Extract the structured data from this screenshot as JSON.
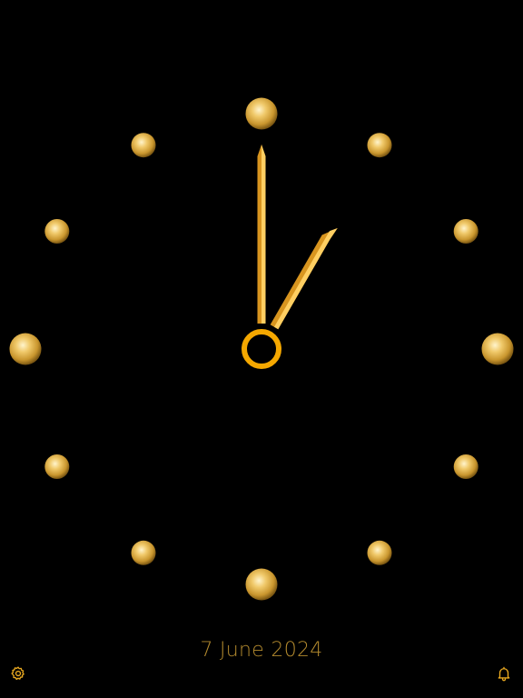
{
  "date_text": "7 June 2024",
  "clock": {
    "time": {
      "hour": 1,
      "minute": 0
    },
    "colors": {
      "background": "#000000",
      "hand_light": "#ffd36a",
      "hand_mid": "#f5b53a",
      "hand_dark": "#d08e1c",
      "marker_light": "#fff2c4",
      "marker_mid": "#e0b450",
      "marker_dark": "#8a6418",
      "date_text": "#b38a2e",
      "icon": "#e8a820"
    }
  },
  "toolbar": {
    "settings_icon": "gear-icon",
    "alarm_icon": "bell-icon"
  }
}
